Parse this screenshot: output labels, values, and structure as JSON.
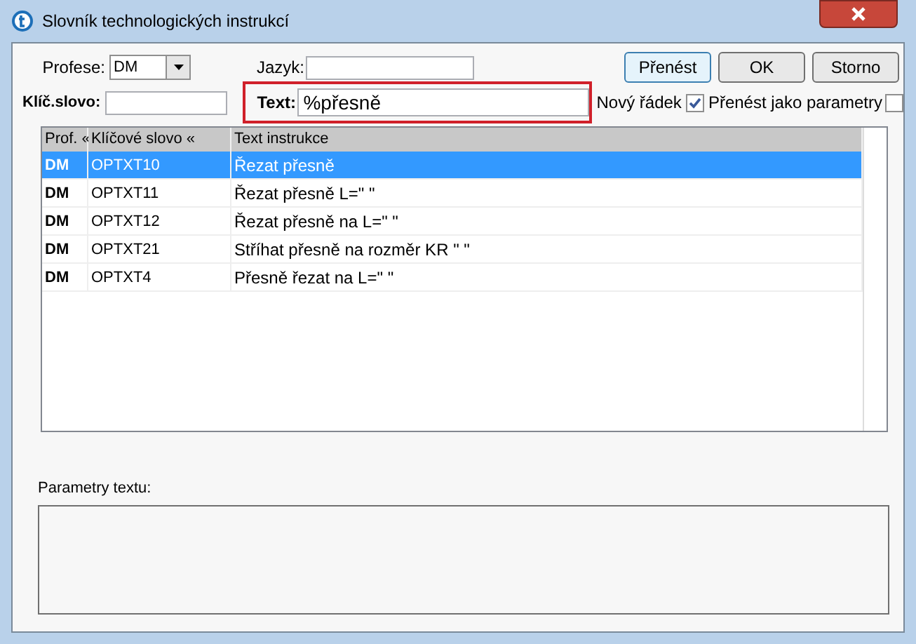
{
  "window": {
    "title": "Slovník technologických instrukcí"
  },
  "form": {
    "profese": {
      "label": "Profese:",
      "value": "DM"
    },
    "jazyk": {
      "label": "Jazyk:"
    },
    "klic": {
      "label": "Klíč.slovo:"
    },
    "text": {
      "label": "Text:",
      "value": "%přesně"
    },
    "novy_radek": {
      "label": "Nový řádek",
      "checked": true
    },
    "jako_parametry": {
      "label": "Přenést jako parametry",
      "checked": false
    }
  },
  "buttons": [
    {
      "label": "Přenést",
      "default": true
    },
    {
      "label": "OK",
      "default": false
    },
    {
      "label": "Storno",
      "default": false
    }
  ],
  "table": {
    "columns": [
      "Prof. «",
      "Klíčové slovo «",
      "Text instrukce"
    ],
    "rows": [
      {
        "cells": [
          "DM",
          "OPTXT10",
          "Řezat přesně"
        ],
        "selected": true
      },
      {
        "cells": [
          "DM",
          "OPTXT11",
          "Řezat přesně L=\" \""
        ],
        "selected": false
      },
      {
        "cells": [
          "DM",
          "OPTXT12",
          "Řezat přesně na L=\" \""
        ],
        "selected": false
      },
      {
        "cells": [
          "DM",
          "OPTXT21",
          "Stříhat přesně na rozměr KR \" \""
        ],
        "selected": false
      },
      {
        "cells": [
          "DM",
          "OPTXT4",
          "Přesně řezat na L=\" \""
        ],
        "selected": false
      }
    ]
  },
  "parameters": {
    "label": "Parametry textu:"
  }
}
